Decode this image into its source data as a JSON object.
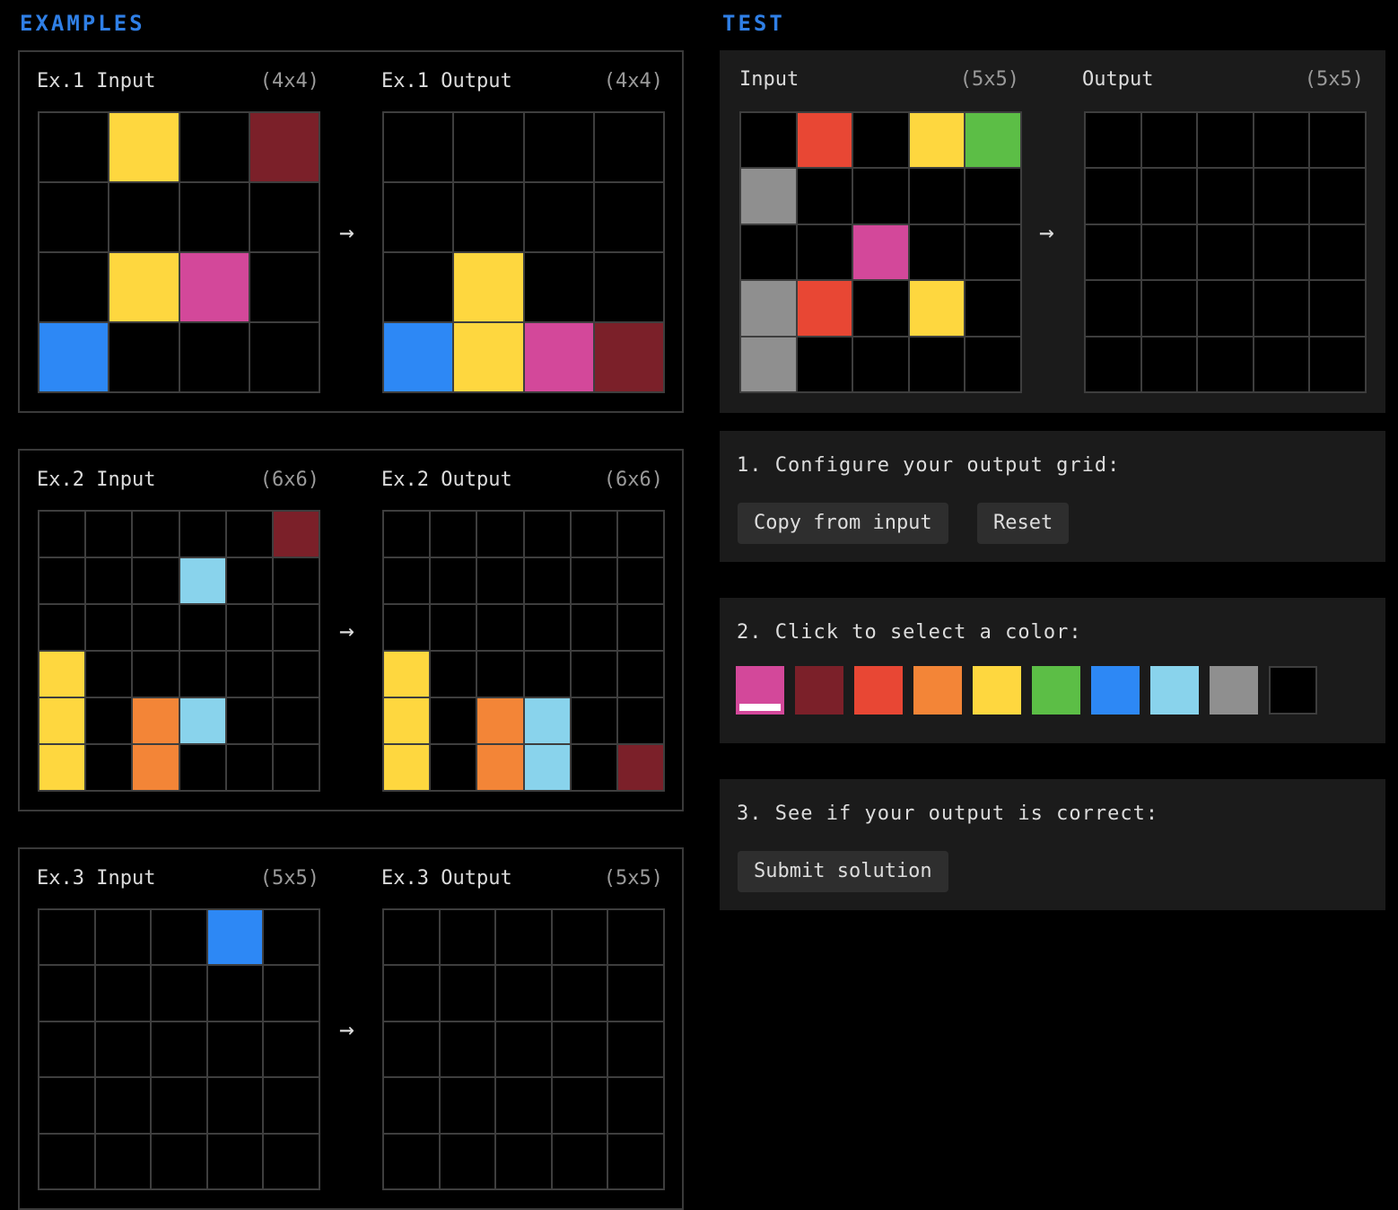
{
  "sections": {
    "examples": "EXAMPLES",
    "test": "TEST"
  },
  "palette": {
    "0": "#000000",
    "1": "#2d88f5",
    "2": "#e84734",
    "3": "#5cbe46",
    "4": "#fed73f",
    "5": "#8f8f8f",
    "6": "#d3489a",
    "7": "#f38537",
    "8": "#89d3ec",
    "9": "#7b2029"
  },
  "examples": [
    {
      "input_label": "Ex.1 Input",
      "input_size": "(4x4)",
      "output_label": "Ex.1 Output",
      "output_size": "(4x4)",
      "input": [
        [
          0,
          4,
          0,
          9
        ],
        [
          0,
          0,
          0,
          0
        ],
        [
          0,
          4,
          6,
          0
        ],
        [
          1,
          0,
          0,
          0
        ]
      ],
      "output": [
        [
          0,
          0,
          0,
          0
        ],
        [
          0,
          0,
          0,
          0
        ],
        [
          0,
          4,
          0,
          0
        ],
        [
          1,
          4,
          6,
          9
        ]
      ]
    },
    {
      "input_label": "Ex.2 Input",
      "input_size": "(6x6)",
      "output_label": "Ex.2 Output",
      "output_size": "(6x6)",
      "input": [
        [
          0,
          0,
          0,
          0,
          0,
          9
        ],
        [
          0,
          0,
          0,
          8,
          0,
          0
        ],
        [
          0,
          0,
          0,
          0,
          0,
          0
        ],
        [
          4,
          0,
          0,
          0,
          0,
          0
        ],
        [
          4,
          0,
          7,
          8,
          0,
          0
        ],
        [
          4,
          0,
          7,
          0,
          0,
          0
        ]
      ],
      "output": [
        [
          0,
          0,
          0,
          0,
          0,
          0
        ],
        [
          0,
          0,
          0,
          0,
          0,
          0
        ],
        [
          0,
          0,
          0,
          0,
          0,
          0
        ],
        [
          4,
          0,
          0,
          0,
          0,
          0
        ],
        [
          4,
          0,
          7,
          8,
          0,
          0
        ],
        [
          4,
          0,
          7,
          8,
          0,
          9
        ]
      ]
    },
    {
      "input_label": "Ex.3 Input",
      "input_size": "(5x5)",
      "output_label": "Ex.3 Output",
      "output_size": "(5x5)",
      "input": [
        [
          0,
          0,
          0,
          1,
          0
        ],
        [
          0,
          0,
          0,
          0,
          0
        ],
        [
          0,
          0,
          0,
          0,
          0
        ],
        [
          0,
          0,
          0,
          0,
          0
        ],
        [
          0,
          0,
          0,
          0,
          0
        ]
      ],
      "output": [
        [
          0,
          0,
          0,
          0,
          0
        ],
        [
          0,
          0,
          0,
          0,
          0
        ],
        [
          0,
          0,
          0,
          0,
          0
        ],
        [
          0,
          0,
          0,
          0,
          0
        ],
        [
          0,
          0,
          0,
          0,
          0
        ]
      ]
    }
  ],
  "test": {
    "input_label": "Input",
    "input_size": "(5x5)",
    "output_label": "Output",
    "output_size": "(5x5)",
    "input": [
      [
        0,
        2,
        0,
        4,
        3
      ],
      [
        5,
        0,
        0,
        0,
        0
      ],
      [
        0,
        0,
        6,
        0,
        0
      ],
      [
        5,
        2,
        0,
        4,
        0
      ],
      [
        5,
        0,
        0,
        0,
        0
      ]
    ],
    "output": [
      [
        0,
        0,
        0,
        0,
        0
      ],
      [
        0,
        0,
        0,
        0,
        0
      ],
      [
        0,
        0,
        0,
        0,
        0
      ],
      [
        0,
        0,
        0,
        0,
        0
      ],
      [
        0,
        0,
        0,
        0,
        0
      ]
    ]
  },
  "arrow": "→",
  "steps": {
    "configure": {
      "title": "1. Configure your output grid:",
      "copy": "Copy from input",
      "reset": "Reset"
    },
    "color": {
      "title": "2. Click to select a color:",
      "selected": 6,
      "swatches": [
        6,
        9,
        2,
        7,
        4,
        3,
        1,
        8,
        5,
        0
      ]
    },
    "submit": {
      "title": "3. See if your output is correct:",
      "button": "Submit solution"
    }
  }
}
